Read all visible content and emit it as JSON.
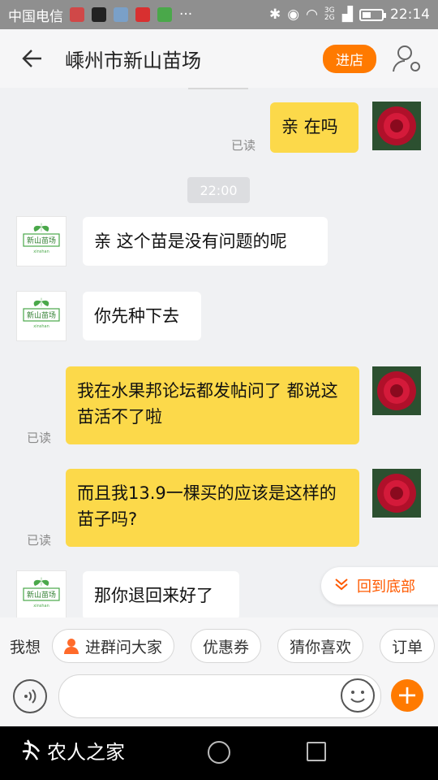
{
  "status_bar": {
    "carrier": "中国电信",
    "network": "3G 2G",
    "time": "22:14"
  },
  "header": {
    "title": "嵊州市新山苗场",
    "shop_button": "进店"
  },
  "shop_avatar": {
    "logo_text": "新山苗场",
    "sub_text": "xinshan"
  },
  "chat": {
    "messages": [
      {
        "sender": "me",
        "text": "亲  在吗",
        "status": "已读"
      },
      {
        "type": "time",
        "text": "22:00"
      },
      {
        "sender": "them",
        "text": "亲  这个苗是没有问题的呢"
      },
      {
        "sender": "them",
        "text": "你先种下去"
      },
      {
        "sender": "me",
        "text": "我在水果邦论坛都发帖问了  都说这苗活不了啦",
        "status": "已读"
      },
      {
        "sender": "me",
        "text": "而且我13.9一棵买的应该是这样的苗子吗?",
        "status": "已读"
      },
      {
        "sender": "them",
        "text": "那你退回来好了"
      }
    ],
    "scroll_to_bottom": "回到底部"
  },
  "quick_bar": {
    "label": "我想",
    "chips": [
      "进群问大家",
      "优惠券",
      "猜你喜欢",
      "订单"
    ]
  },
  "input": {
    "placeholder": ""
  },
  "nav": {
    "watermark": "农人之家"
  },
  "colors": {
    "accent": "#ff7a00",
    "my_bubble": "#fcd94a",
    "their_bubble": "#ffffff"
  }
}
